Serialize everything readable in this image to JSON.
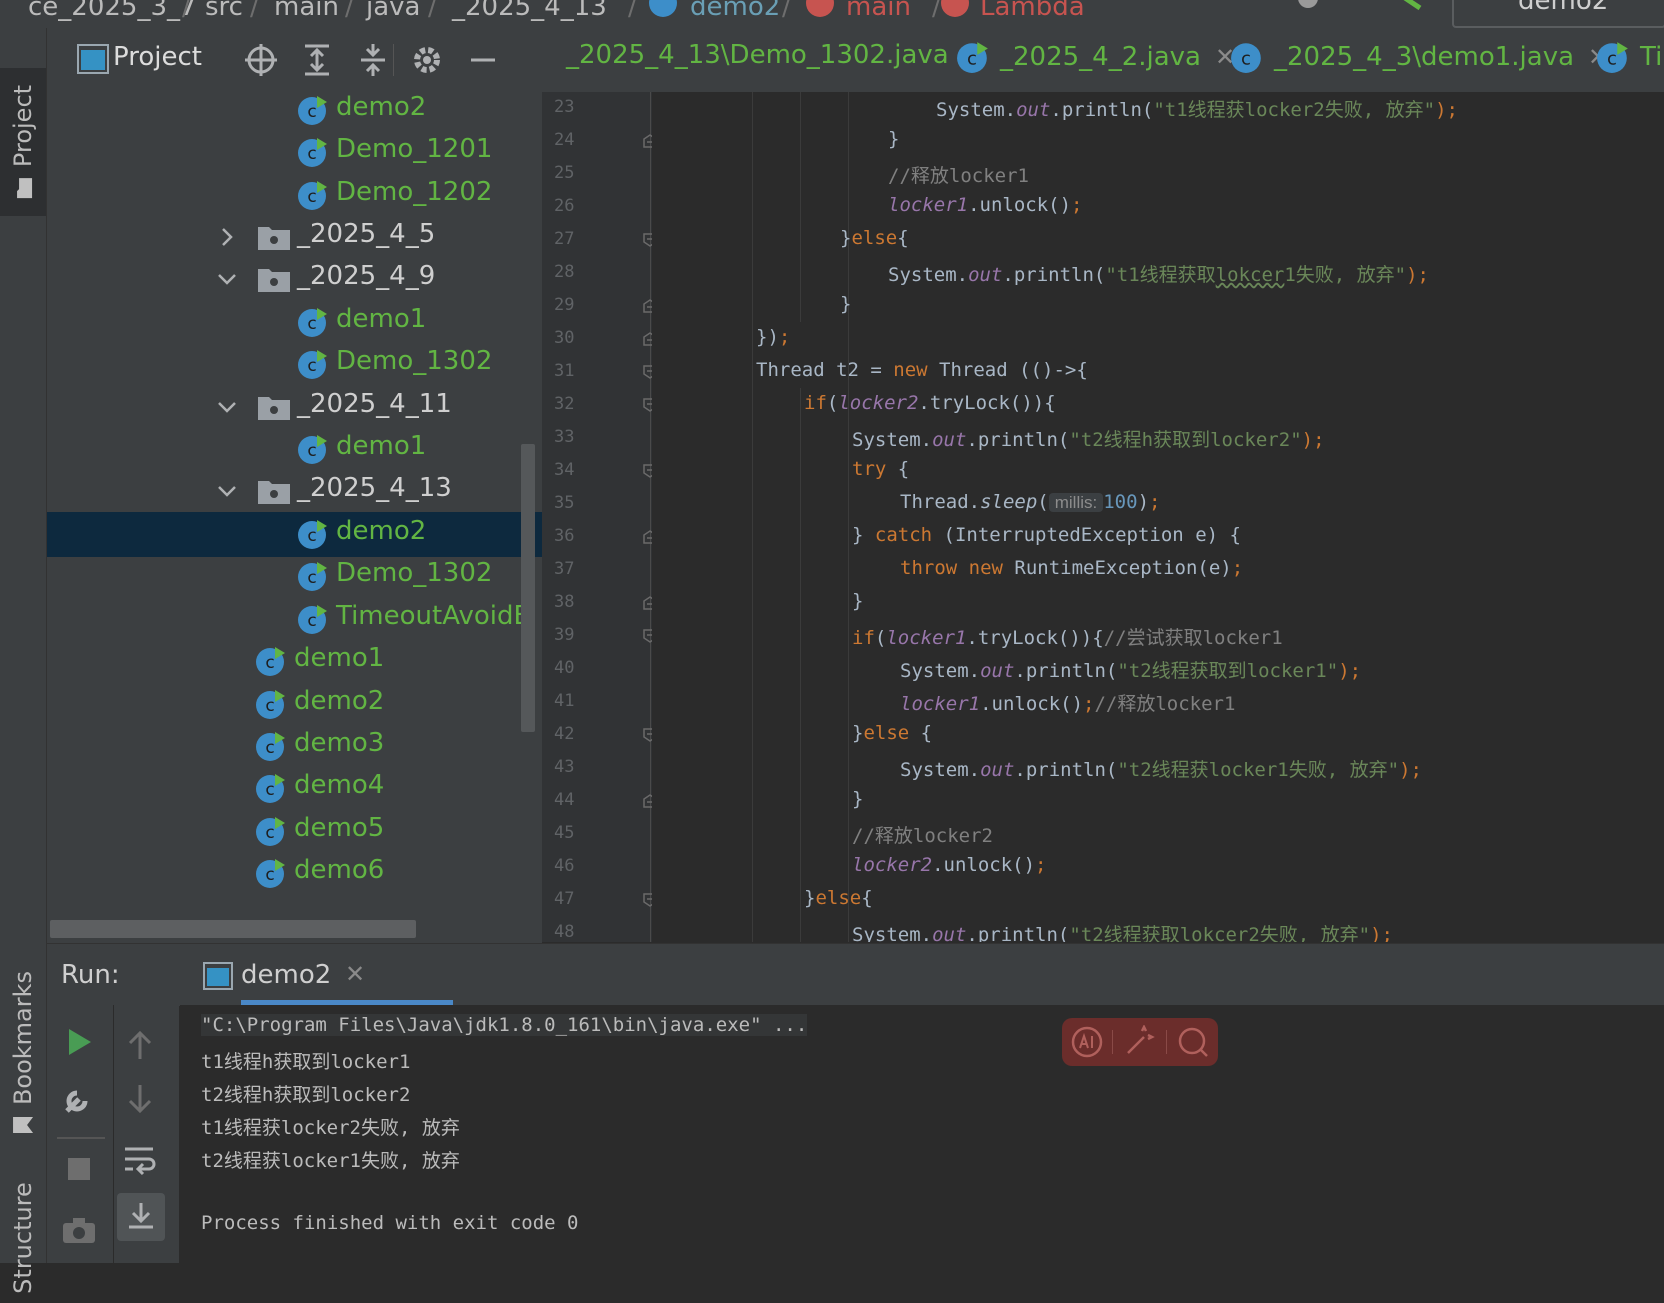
{
  "breadcrumb": {
    "items": [
      "ce_2025_3_7",
      "src",
      "main",
      "java",
      "_2025_4_13",
      "demo2",
      "main",
      "Lambda"
    ],
    "run_config": "demo2"
  },
  "left_stripe": {
    "project": "Project",
    "bookmarks": "Bookmarks",
    "structure": "Structure"
  },
  "project_panel": {
    "title": "Project",
    "tree": [
      {
        "label": "demo2",
        "kind": "class",
        "depth": 2
      },
      {
        "label": "Demo_1201",
        "kind": "class",
        "depth": 2
      },
      {
        "label": "Demo_1202",
        "kind": "class",
        "depth": 2
      },
      {
        "label": "_2025_4_5",
        "kind": "folder",
        "expanded": false,
        "depth": 1
      },
      {
        "label": "_2025_4_9",
        "kind": "folder",
        "expanded": true,
        "depth": 1
      },
      {
        "label": "demo1",
        "kind": "class",
        "depth": 2
      },
      {
        "label": "Demo_1302",
        "kind": "class",
        "depth": 2
      },
      {
        "label": "_2025_4_11",
        "kind": "folder",
        "expanded": true,
        "depth": 1
      },
      {
        "label": "demo1",
        "kind": "class",
        "depth": 2
      },
      {
        "label": "_2025_4_13",
        "kind": "folder",
        "expanded": true,
        "depth": 1
      },
      {
        "label": "demo2",
        "kind": "class",
        "depth": 2,
        "selected": true
      },
      {
        "label": "Demo_1302",
        "kind": "class",
        "depth": 2
      },
      {
        "label": "TimeoutAvoidE",
        "kind": "class",
        "depth": 2
      },
      {
        "label": "demo1",
        "kind": "class",
        "depth": 1
      },
      {
        "label": "demo2",
        "kind": "class",
        "depth": 1
      },
      {
        "label": "demo3",
        "kind": "class",
        "depth": 1
      },
      {
        "label": "demo4",
        "kind": "class",
        "depth": 1
      },
      {
        "label": "demo5",
        "kind": "class",
        "depth": 1
      },
      {
        "label": "demo6",
        "kind": "class",
        "depth": 1
      }
    ]
  },
  "editor_tabs": [
    {
      "label": "_2025_4_13\\Demo_1302.java",
      "has_icon": false
    },
    {
      "label": "_2025_4_2.java",
      "has_icon": true
    },
    {
      "label": "_2025_4_3\\demo1.java",
      "has_icon": true
    },
    {
      "label": "Ti",
      "has_icon": true
    }
  ],
  "editor": {
    "line_numbers": [
      "23",
      "24",
      "25",
      "26",
      "27",
      "28",
      "29",
      "30",
      "31",
      "32",
      "33",
      "34",
      "35",
      "36",
      "37",
      "38",
      "39",
      "40",
      "41",
      "42",
      "43",
      "44",
      "45",
      "46",
      "47",
      "48"
    ],
    "code": {
      "l23_a": "System.",
      "l23_b": "out",
      "l23_c": ".println(",
      "l23_d": "\"t1线程获locker2失败, 放弃\"",
      "l23_e": ");",
      "l24": "}",
      "l25": "//释放locker1",
      "l26_a": "locker1",
      "l26_b": ".unlock()",
      "l26_c": ";",
      "l27_a": "}",
      "l27_b": "else",
      "l27_c": "{",
      "l28_a": "System.",
      "l28_b": "out",
      "l28_c": ".println(",
      "l28_d": "\"t1线程获取",
      "l28_e": "lokcer",
      "l28_f": "1失败, 放弃\"",
      "l28_g": ");",
      "l29": "}",
      "l30_a": "})",
      "l30_b": ";",
      "l31_a": "Thread t2 = ",
      "l31_b": "new",
      "l31_c": " Thread (()->{",
      "l32_a": "if",
      "l32_b": "(",
      "l32_c": "locker2",
      "l32_d": ".tryLock()){",
      "l33_a": "System.",
      "l33_b": "out",
      "l33_c": ".println(",
      "l33_d": "\"t2线程h获取到locker2\"",
      "l33_e": ");",
      "l34_a": "try",
      "l34_b": " {",
      "l35_a": "Thread.",
      "l35_b": "sleep",
      "l35_c": "(",
      "l35_hint": "millis:",
      "l35_d": "100",
      "l35_e": ")",
      "l35_f": ";",
      "l36_a": "} ",
      "l36_b": "catch",
      "l36_c": " (InterruptedException e) {",
      "l37_a": "throw new",
      "l37_b": " RuntimeException(e)",
      "l37_c": ";",
      "l38": "}",
      "l39_a": "if",
      "l39_b": "(",
      "l39_c": "locker1",
      "l39_d": ".tryLock()){",
      "l39_e": "//尝试获取locker1",
      "l40_a": "System.",
      "l40_b": "out",
      "l40_c": ".println(",
      "l40_d": "\"t2线程获取到locker1\"",
      "l40_e": ");",
      "l41_a": "locker1",
      "l41_b": ".unlock()",
      "l41_c": ";",
      "l41_d": "//释放locker1",
      "l42_a": "}",
      "l42_b": "else",
      "l42_c": " {",
      "l43_a": "System.",
      "l43_b": "out",
      "l43_c": ".println(",
      "l43_d": "\"t2线程获locker1失败, 放弃\"",
      "l43_e": ");",
      "l44": "}",
      "l45": "//释放locker2",
      "l46_a": "locker2",
      "l46_b": ".unlock()",
      "l46_c": ";",
      "l47_a": "}",
      "l47_b": "else",
      "l47_c": "{",
      "l48_a": "System.",
      "l48_b": "out",
      "l48_c": ".println(",
      "l48_d": "\"t2线程获取",
      "l48_e": "lokcer",
      "l48_f": "2失败, 放弃\"",
      "l48_g": ");"
    }
  },
  "run_panel": {
    "label": "Run:",
    "tab_label": "demo2",
    "console": [
      "\"C:\\Program Files\\Java\\jdk1.8.0_161\\bin\\java.exe\" ...",
      "t1线程h获取到locker1",
      "t2线程h获取到locker2",
      "t1线程获locker2失败, 放弃",
      "t2线程获locker1失败, 放弃",
      "",
      "Process finished with exit code 0"
    ]
  },
  "colors": {
    "accent": "#4a88c7",
    "class_name_green": "#62b543",
    "selection": "#0d293e",
    "keyword": "#cc7832",
    "string": "#6a8759"
  }
}
